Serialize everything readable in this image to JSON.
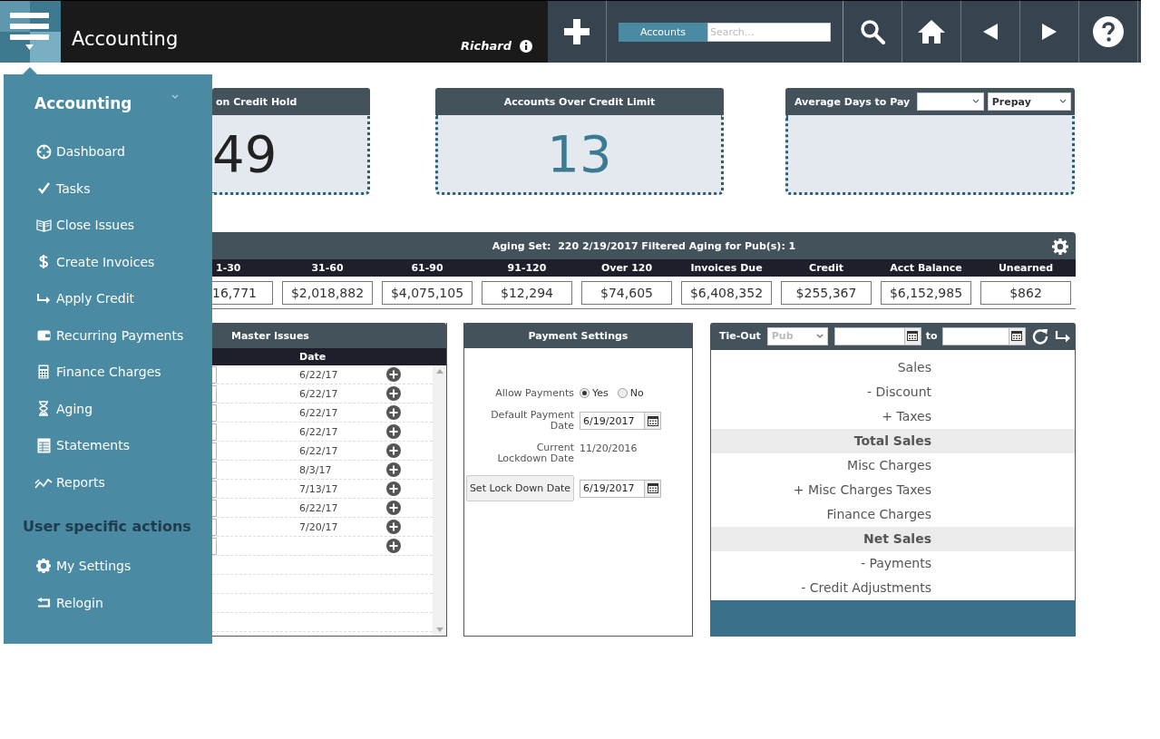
{
  "header": {
    "title": "Accounting",
    "user": "Richard",
    "search": {
      "scope": "Accounts",
      "placeholder": "Search..."
    }
  },
  "menu": {
    "title": "Accounting",
    "items": [
      {
        "label": "Dashboard",
        "kind": "dashboard"
      },
      {
        "label": "Tasks",
        "kind": "tasks"
      },
      {
        "label": "Close Issues",
        "kind": "book"
      },
      {
        "label": "Create Invoices",
        "kind": "dollar"
      },
      {
        "label": "Apply Credit",
        "kind": "arrow"
      },
      {
        "label": "Recurring Payments",
        "kind": "wallet"
      },
      {
        "label": "Finance Charges",
        "kind": "calculator"
      },
      {
        "label": "Aging",
        "kind": "hourglass"
      },
      {
        "label": "Statements",
        "kind": "sheet"
      },
      {
        "label": "Reports",
        "kind": "chart"
      }
    ],
    "section": "User specific actions",
    "user_items": [
      {
        "label": "My Settings",
        "kind": "gear"
      },
      {
        "label": "Relogin",
        "kind": "return"
      }
    ]
  },
  "cards": [
    {
      "kind": "count",
      "title": "on Credit Hold",
      "value": "49",
      "color": "#222222"
    },
    {
      "kind": "count",
      "title": "Accounts Over Credit Limit",
      "value": "13",
      "color": "#3a7a92"
    },
    {
      "kind": "filters",
      "title": "Average Days to Pay",
      "filters": [
        {
          "kind": "select"
        },
        {
          "kind": "select",
          "value": "Prepay"
        }
      ]
    }
  ],
  "aging": {
    "title": "Aging Set:  220 2/19/2017 Filtered Aging for Pub(s): 1",
    "columns": [
      {
        "label": "1-30",
        "value": "16,771"
      },
      {
        "label": "31-60",
        "value": "$2,018,882"
      },
      {
        "label": "61-90",
        "value": "$4,075,105"
      },
      {
        "label": "91-120",
        "value": "$12,294"
      },
      {
        "label": "Over 120",
        "value": "$74,605"
      },
      {
        "label": "Invoices Due",
        "value": "$6,408,352"
      },
      {
        "label": "Credit",
        "value": "$255,367"
      },
      {
        "label": "Acct Balance",
        "value": "$6,152,985"
      },
      {
        "label": "Unearned",
        "value": "$862"
      }
    ]
  },
  "master_issues": {
    "title": "Master Issues",
    "column": "Date",
    "rows": [
      {
        "kind": "dated",
        "date": "6/22/17"
      },
      {
        "kind": "dated",
        "date": "6/22/17"
      },
      {
        "kind": "dated",
        "date": "6/22/17"
      },
      {
        "kind": "dated",
        "date": "6/22/17"
      },
      {
        "kind": "dated",
        "date": "6/22/17"
      },
      {
        "kind": "dated",
        "date": "8/3/17"
      },
      {
        "kind": "dated",
        "date": "7/13/17"
      },
      {
        "kind": "dated",
        "date": "6/22/17"
      },
      {
        "kind": "dated",
        "date": "7/20/17"
      },
      {
        "kind": "empty"
      }
    ]
  },
  "payment_settings": {
    "title": "Payment Settings",
    "allow_payments": {
      "label": "Allow Payments",
      "options": [
        {
          "label": "Yes",
          "selected": true
        },
        {
          "label": "No",
          "selected": false
        }
      ]
    },
    "default_payment_date": {
      "label": "Default Payment Date",
      "value": "6/19/2017"
    },
    "current_lockdown_date": {
      "label": "Current Lockdown Date",
      "value": "11/20/2016"
    },
    "set_lock_down": {
      "button": "Set Lock Down Date",
      "value": "6/19/2017"
    }
  },
  "tie_out": {
    "title": "Tie-Out",
    "pub_placeholder": "Pub",
    "to": "to",
    "lines": [
      {
        "label": "Sales",
        "kind": "line"
      },
      {
        "label": "- Discount",
        "kind": "line"
      },
      {
        "label": "+ Taxes",
        "kind": "line"
      },
      {
        "label": "Total Sales",
        "kind": "total"
      },
      {
        "label": "Misc Charges",
        "kind": "line"
      },
      {
        "label": "+ Misc Charges Taxes",
        "kind": "line"
      },
      {
        "label": "Finance Charges",
        "kind": "line"
      },
      {
        "label": "Net Sales",
        "kind": "total"
      },
      {
        "label": "- Payments",
        "kind": "line"
      },
      {
        "label": "- Credit Adjustments",
        "kind": "line"
      }
    ]
  }
}
